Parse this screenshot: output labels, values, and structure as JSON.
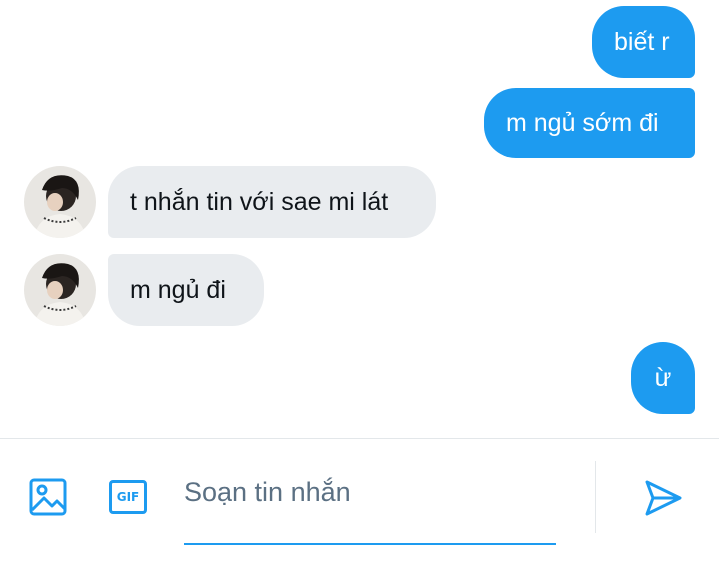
{
  "messages": [
    {
      "direction": "outgoing",
      "text": "biết r"
    },
    {
      "direction": "outgoing",
      "text": "m ngủ sớm đi"
    },
    {
      "direction": "incoming",
      "text": "t nhắn tin với sae mi lát"
    },
    {
      "direction": "incoming",
      "text": "m ngủ đi"
    },
    {
      "direction": "outgoing",
      "text": "ừ"
    }
  ],
  "composer": {
    "placeholder": "Soạn tin nhắn",
    "gif_label": "GIF",
    "icons": [
      "image-icon",
      "gif-icon",
      "send-icon"
    ]
  },
  "colors": {
    "accent": "#1d9bf0",
    "incoming_bubble": "#e9ecef",
    "text": "#0f1419",
    "placeholder": "#5b7083"
  }
}
